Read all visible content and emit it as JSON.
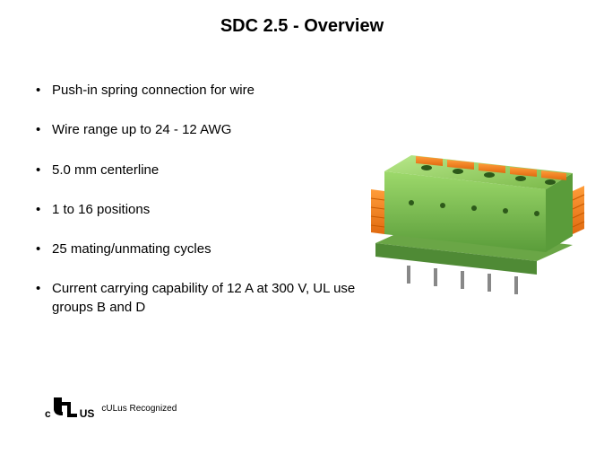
{
  "title": "SDC 2.5 - Overview",
  "bullets": [
    "Push-in spring connection for wire",
    "Wire range up to 24 - 12 AWG",
    "5.0 mm centerline",
    "1 to 16 positions",
    "25 mating/unmating cycles",
    "Current carrying capability of 12 A at 300 V, UL use groups B and D"
  ],
  "certification": {
    "prefix": "c",
    "suffix": "US",
    "label": "cULus Recognized"
  },
  "product": {
    "name": "SDC 2.5 Connector",
    "body_color": "#7ab849",
    "accent_color": "#f58220"
  }
}
